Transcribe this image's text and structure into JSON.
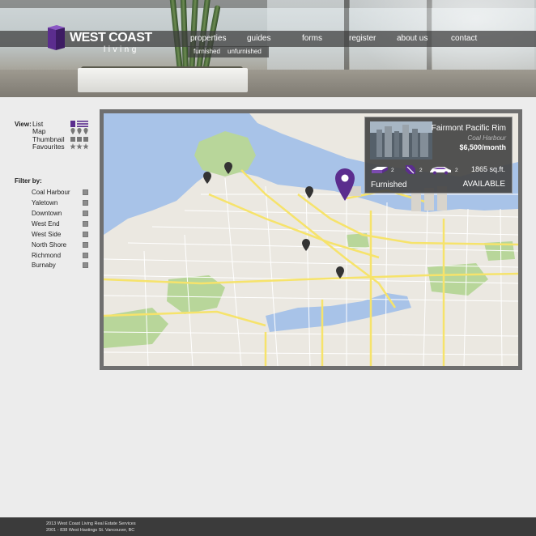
{
  "brand": {
    "name": "WEST COAST",
    "tagline": "living"
  },
  "nav": {
    "items": [
      {
        "label": "properties"
      },
      {
        "label": "guides"
      },
      {
        "label": "forms"
      },
      {
        "label": "register"
      },
      {
        "label": "about us"
      },
      {
        "label": "contact"
      }
    ],
    "sub_items": [
      {
        "label": "furnished"
      },
      {
        "label": "unfurnished"
      }
    ]
  },
  "sidebar": {
    "view_label": "View:",
    "view_options": [
      {
        "label": "List",
        "icon": "list-icon",
        "selected": true
      },
      {
        "label": "Map",
        "icon": "map-pin-icon",
        "selected": false
      },
      {
        "label": "Thumbnail",
        "icon": "thumbnail-icon",
        "selected": false
      },
      {
        "label": "Favourites",
        "icon": "star-icon",
        "selected": false
      }
    ],
    "filter_label": "Filter by:",
    "filters": [
      {
        "label": "Coal Harbour"
      },
      {
        "label": "Yaletown"
      },
      {
        "label": "Downtown"
      },
      {
        "label": "West End"
      },
      {
        "label": "West Side"
      },
      {
        "label": "North Shore"
      },
      {
        "label": "Richmond"
      },
      {
        "label": "Burnaby"
      }
    ]
  },
  "listing": {
    "title": "Fairmont Pacific Rim",
    "neighbourhood": "Coal Harbour",
    "price": "$6,500/month",
    "beds": "2",
    "baths": "2",
    "parking": "2",
    "area": "1865 sq.ft.",
    "furnishing": "Furnished",
    "status": "AVAILABLE"
  },
  "footer": {
    "line1": "2013 West Coast Living Real Estate Services",
    "line2": "2001 - 838 West Hastings St. Vancouver, BC"
  },
  "colors": {
    "accent": "#5b2d8e",
    "nav_bg": "#3c3c3c",
    "page_bg": "#ececec",
    "map_water": "#a8c3e8",
    "map_land": "#ebe8e1",
    "map_park": "#b8d69a",
    "map_road_major": "#f6e36b"
  }
}
